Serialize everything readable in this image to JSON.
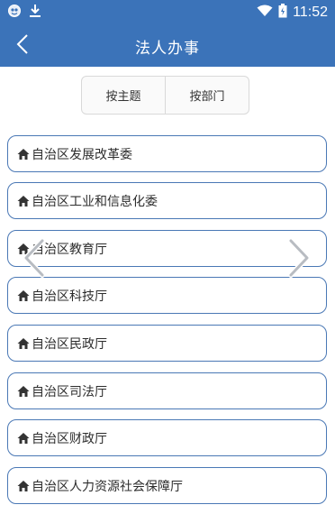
{
  "status_bar": {
    "time": "11:52",
    "left_icons": [
      "app-icon",
      "download-icon"
    ],
    "right_icons": [
      "wifi-icon",
      "battery-icon"
    ]
  },
  "header": {
    "title": "法人办事",
    "back_icon": "chevron-left-icon"
  },
  "tabs": [
    {
      "label": "按主题"
    },
    {
      "label": "按部门"
    }
  ],
  "departments": [
    {
      "label": "自治区发展改革委"
    },
    {
      "label": "自治区工业和信息化委"
    },
    {
      "label": "自治区教育厅"
    },
    {
      "label": "自治区科技厅"
    },
    {
      "label": "自治区民政厅"
    },
    {
      "label": "自治区司法厅"
    },
    {
      "label": "自治区财政厅"
    },
    {
      "label": "自治区人力资源社会保障厅"
    }
  ],
  "carousel": {
    "prev_icon": "chevron-left-icon",
    "next_icon": "chevron-right-icon"
  },
  "colors": {
    "header_bg": "#3b73b9",
    "item_border": "#4a78b5",
    "text": "#2d2d2d"
  }
}
